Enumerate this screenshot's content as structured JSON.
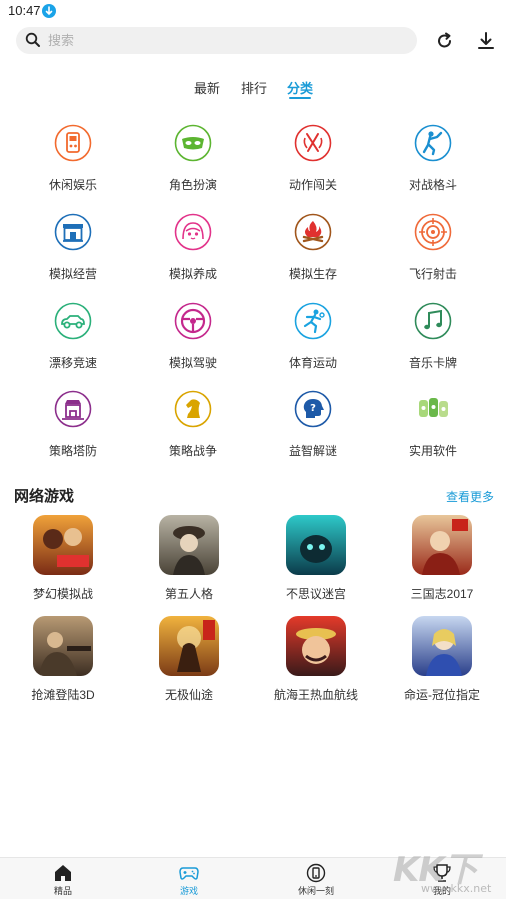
{
  "status": {
    "time": "10:47"
  },
  "search": {
    "placeholder": "搜索"
  },
  "tabs": [
    {
      "label": "最新",
      "active": false
    },
    {
      "label": "排行",
      "active": false
    },
    {
      "label": "分类",
      "active": true
    }
  ],
  "categories": [
    {
      "label": "休闲娱乐",
      "icon": "gamepad-icon",
      "color": "#f26a2e"
    },
    {
      "label": "角色扮演",
      "icon": "mask-icon",
      "color": "#5cb531"
    },
    {
      "label": "动作闯关",
      "icon": "sword-icon",
      "color": "#e0312f"
    },
    {
      "label": "对战格斗",
      "icon": "fighter-icon",
      "color": "#1a8fd0"
    },
    {
      "label": "模拟经营",
      "icon": "shop-icon",
      "color": "#1e6fb8"
    },
    {
      "label": "模拟养成",
      "icon": "girl-icon",
      "color": "#e2338a"
    },
    {
      "label": "模拟生存",
      "icon": "campfire-icon",
      "color": "#a0561c"
    },
    {
      "label": "飞行射击",
      "icon": "target-icon",
      "color": "#ef6a3a"
    },
    {
      "label": "漂移竞速",
      "icon": "car-icon",
      "color": "#2bb07a"
    },
    {
      "label": "模拟驾驶",
      "icon": "steering-wheel-icon",
      "color": "#c4288c"
    },
    {
      "label": "体育运动",
      "icon": "athlete-icon",
      "color": "#1aa3e0"
    },
    {
      "label": "音乐卡牌",
      "icon": "music-note-icon",
      "color": "#2f8b5a"
    },
    {
      "label": "策略塔防",
      "icon": "tower-icon",
      "color": "#8c2f8c"
    },
    {
      "label": "策略战争",
      "icon": "chess-knight-icon",
      "color": "#d9a400"
    },
    {
      "label": "益智解谜",
      "icon": "puzzle-head-icon",
      "color": "#1e5aa8"
    },
    {
      "label": "实用软件",
      "icon": "tool-icon",
      "color": "#6ab84a"
    }
  ],
  "online": {
    "title": "网络游戏",
    "more": "查看更多",
    "games": [
      {
        "name": "梦幻模拟战",
        "art": [
          "#f0a23a",
          "#7a2b15"
        ]
      },
      {
        "name": "第五人格",
        "art": [
          "#b8b3a4",
          "#4a4337"
        ]
      },
      {
        "name": "不思议迷宫",
        "art": [
          "#2ec9c9",
          "#0b3b4a"
        ]
      },
      {
        "name": "三国志2017",
        "art": [
          "#e8c69a",
          "#9a2a1a"
        ]
      },
      {
        "name": "抢滩登陆3D",
        "art": [
          "#b89a74",
          "#3d2e22"
        ]
      },
      {
        "name": "无极仙途",
        "art": [
          "#f1b33e",
          "#7b3b16"
        ]
      },
      {
        "name": "航海王热血航线",
        "art": [
          "#e43a2a",
          "#3a1a1a"
        ]
      },
      {
        "name": "命运-冠位指定",
        "art": [
          "#c7d7f0",
          "#2a3f8a"
        ]
      }
    ]
  },
  "nav": [
    {
      "label": "精品",
      "icon": "home-icon",
      "active": false
    },
    {
      "label": "游戏",
      "icon": "gamepad-icon",
      "active": true
    },
    {
      "label": "休闲一刻",
      "icon": "phone-icon",
      "active": false
    },
    {
      "label": "我的",
      "icon": "trophy-icon",
      "active": false
    }
  ],
  "watermark": {
    "logo": "KK下载",
    "site": "www.kkx.net"
  },
  "colors": {
    "accent": "#1a9bd7",
    "search_bg": "#f0f0f0",
    "nav_bg": "#f7f7f7"
  }
}
